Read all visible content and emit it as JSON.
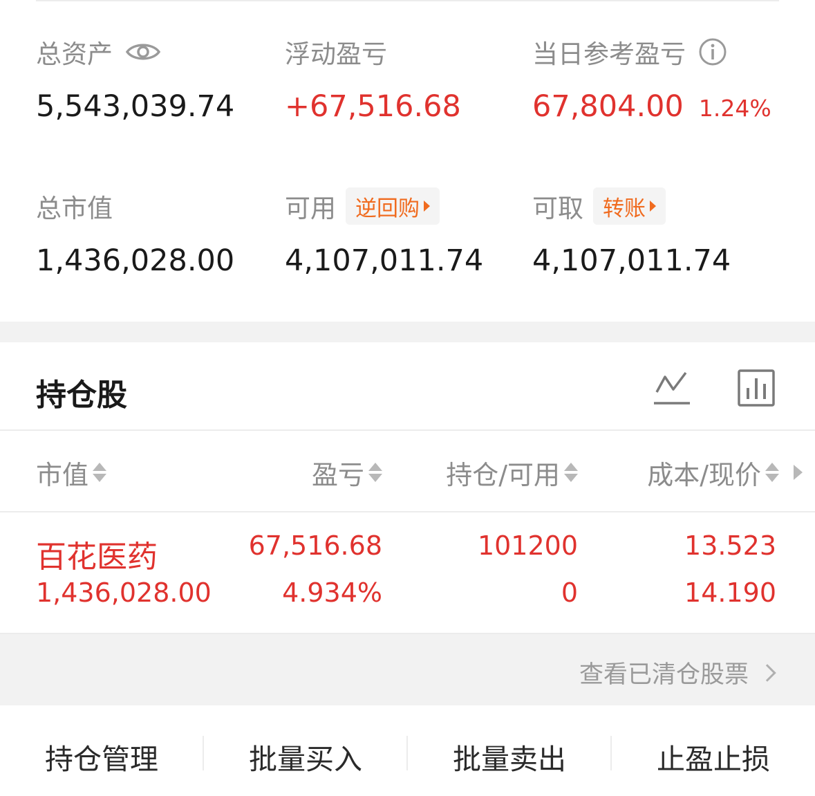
{
  "summary": {
    "total_assets": {
      "label": "总资产",
      "value": "5,543,039.74"
    },
    "floating_pl": {
      "label": "浮动盈亏",
      "value": "+67,516.68"
    },
    "daily_pl": {
      "label": "当日参考盈亏",
      "value": "67,804.00",
      "percent": "1.24%"
    },
    "market_value": {
      "label": "总市值",
      "value": "1,436,028.00"
    },
    "available": {
      "label": "可用",
      "value": "4,107,011.74",
      "chip": "逆回购"
    },
    "withdrawable": {
      "label": "可取",
      "value": "4,107,011.74",
      "chip": "转账"
    }
  },
  "holdings": {
    "title": "持仓股",
    "columns": [
      "市值",
      "盈亏",
      "持仓/可用",
      "成本/现价"
    ],
    "rows": [
      {
        "name": "百花医药",
        "market_value": "1,436,028.00",
        "pl": "67,516.68",
        "pl_pct": "4.934%",
        "position": "101200",
        "available": "0",
        "cost": "13.523",
        "price": "14.190"
      }
    ],
    "cleared_link": "查看已清仓股票"
  },
  "actions": [
    "持仓管理",
    "批量买入",
    "批量卖出",
    "止盈止损"
  ],
  "colors": {
    "up_red": "#e0322e",
    "chip_orange": "#f06b1f",
    "label_gray": "#8c8c8c"
  },
  "icons": [
    "eye-icon",
    "info-icon",
    "line-chart-icon",
    "bar-chart-icon",
    "sort-icon",
    "chevron-right-icon"
  ]
}
